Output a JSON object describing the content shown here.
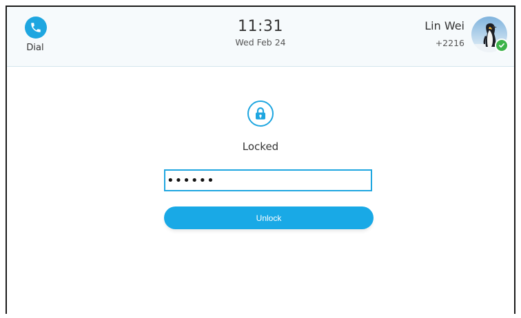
{
  "header": {
    "dial_label": "Dial",
    "time": "11:31",
    "date": "Wed Feb 24",
    "account_name": "Lin Wei",
    "account_extension": "+2216",
    "status": "online"
  },
  "lock_screen": {
    "status_label": "Locked",
    "password_value": "••••••",
    "unlock_label": "Unlock"
  },
  "colors": {
    "accent": "#1ea6e0",
    "online": "#3db34a"
  },
  "icons": [
    "phone-icon",
    "lock-icon",
    "avatar-penguin",
    "online-check-icon"
  ]
}
